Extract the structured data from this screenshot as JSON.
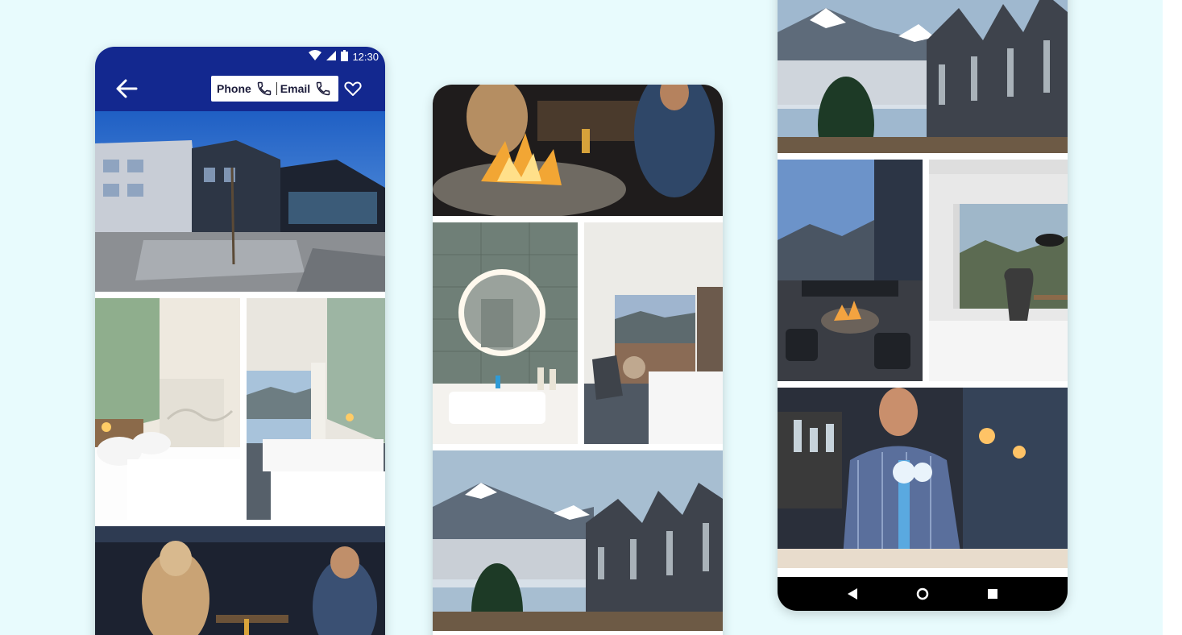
{
  "status_bar": {
    "time": "12:30"
  },
  "app_bar": {
    "phone_label": "Phone",
    "email_label": "Email"
  },
  "icons": {
    "back": "arrow-left-icon",
    "phone": "phone-icon",
    "favorite": "heart-outline-icon",
    "wifi": "wifi-icon",
    "signal": "signal-icon",
    "battery": "battery-icon",
    "nav_back": "triangle-back-icon",
    "nav_home": "circle-home-icon",
    "nav_recents": "square-recents-icon"
  },
  "colors": {
    "background": "#e8fbfd",
    "app_bar": "#13288f",
    "nav_bar": "#000000"
  }
}
